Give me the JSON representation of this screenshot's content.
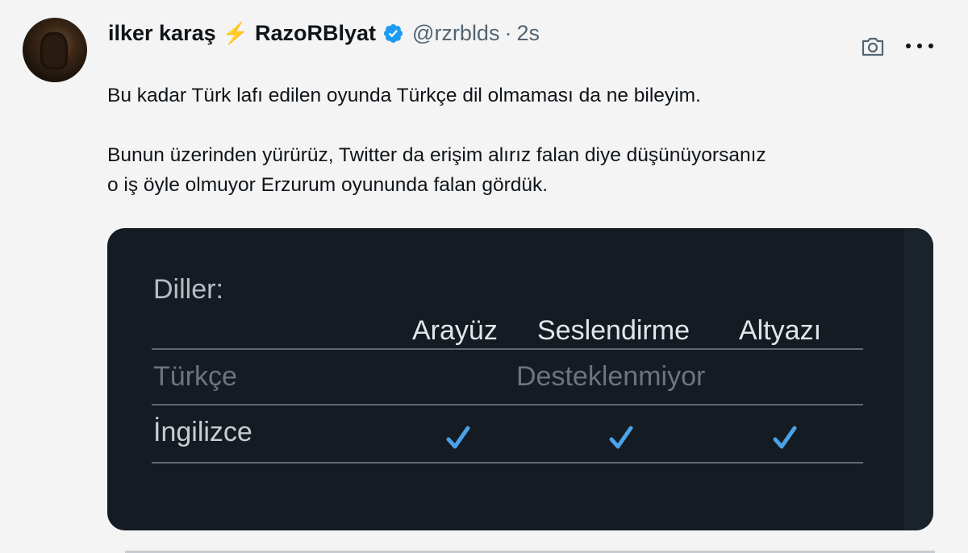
{
  "tweet": {
    "author_name": "ilker karaş",
    "bolt_emoji": "⚡",
    "display_name": "RazoRBlyat",
    "handle": "@rzrblds",
    "separator": "·",
    "time": "2s",
    "text_line1": "Bu kadar Türk lafı edilen oyunda Türkçe dil olmaması da ne bileyim.",
    "text_line2": "Bunun üzerinden yürürüz, Twitter da erişim alırız falan diye düşünüyorsanız",
    "text_line3": "o iş öyle olmuyor Erzurum oyununda falan gördük."
  },
  "media": {
    "title": "Diller:",
    "columns": [
      "Arayüz",
      "Seslendirme",
      "Altyazı"
    ],
    "rows": [
      {
        "language": "Türkçe",
        "status": "Desteklenmiyor"
      },
      {
        "language": "İngilizce",
        "checks": [
          true,
          true,
          true
        ]
      }
    ]
  },
  "colors": {
    "verified": "#1d9bf0",
    "check": "#4aa3e8",
    "media_bg": "#141b23"
  },
  "icons": [
    "camera-icon",
    "more-icon",
    "verified-icon",
    "check-icon"
  ]
}
